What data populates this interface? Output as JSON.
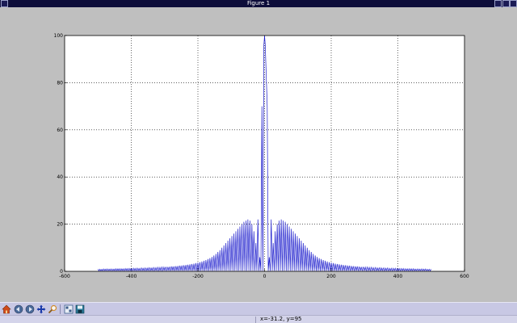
{
  "window": {
    "title": "Figure 1"
  },
  "toolbar": {
    "tools": [
      {
        "name": "home-icon",
        "color": "#d04a1a"
      },
      {
        "name": "back-icon",
        "color": "#4a6a9a"
      },
      {
        "name": "forward-icon",
        "color": "#4a6a9a"
      },
      {
        "name": "pan-icon",
        "color": "#1a3aaa"
      },
      {
        "name": "zoom-icon",
        "color": "#d08a2a"
      },
      {
        "name": "subplots-icon",
        "color": "#3a5a8a"
      },
      {
        "name": "save-icon",
        "color": "#2a7a9a"
      }
    ]
  },
  "status": {
    "coords": "x=-31.2, y=95"
  },
  "chart_data": {
    "type": "line",
    "title": "",
    "xlabel": "",
    "ylabel": "",
    "xlim": [
      -600,
      600
    ],
    "ylim": [
      0,
      100
    ],
    "xticks": [
      "-600",
      "-400",
      "-200",
      "0",
      "200",
      "400",
      "600"
    ],
    "yticks": [
      "0",
      "20",
      "40",
      "60",
      "80",
      "100"
    ],
    "grid": true,
    "line_color": "#1a1acc",
    "series": [
      {
        "x": [
          -500,
          -494,
          -488,
          -482,
          -476,
          -470,
          -464,
          -458,
          -452,
          -446,
          -440,
          -434,
          -428,
          -422,
          -416,
          -410,
          -404,
          -398,
          -392,
          -386,
          -380,
          -374,
          -368,
          -362,
          -356,
          -350,
          -344,
          -338,
          -332,
          -326,
          -320,
          -314,
          -308,
          -302,
          -296,
          -290,
          -284,
          -278,
          -272,
          -266,
          -260,
          -254,
          -248,
          -242,
          -236,
          -230,
          -224,
          -218,
          -212,
          -206,
          -200,
          -194,
          -188,
          -182,
          -176,
          -170,
          -164,
          -158,
          -152,
          -146,
          -140,
          -134,
          -128,
          -122,
          -116,
          -110,
          -104,
          -98,
          -92,
          -86,
          -80,
          -74,
          -68,
          -62,
          -56,
          -50,
          -44,
          -38,
          -32,
          -26,
          -20,
          -14,
          -8,
          -2,
          0,
          2,
          8,
          14,
          20,
          26,
          32,
          38,
          44,
          50,
          56,
          62,
          68,
          74,
          80,
          86,
          92,
          98,
          104,
          110,
          116,
          122,
          128,
          134,
          140,
          146,
          152,
          158,
          164,
          170,
          176,
          182,
          188,
          194,
          200,
          206,
          212,
          218,
          224,
          230,
          236,
          242,
          248,
          254,
          260,
          266,
          272,
          278,
          284,
          290,
          296,
          302,
          308,
          314,
          320,
          326,
          332,
          338,
          344,
          350,
          356,
          362,
          368,
          374,
          380,
          386,
          392,
          398,
          404,
          410,
          416,
          422,
          428,
          434,
          440,
          446,
          452,
          458,
          464,
          470,
          476,
          482,
          488,
          494,
          500
        ],
        "y": [
          0.9,
          0.9,
          0.9,
          1.0,
          1.0,
          1.0,
          1.0,
          1.0,
          1.0,
          1.1,
          1.1,
          1.1,
          1.1,
          1.1,
          1.2,
          1.2,
          1.2,
          1.2,
          1.3,
          1.3,
          1.3,
          1.3,
          1.4,
          1.4,
          1.4,
          1.5,
          1.5,
          1.5,
          1.6,
          1.6,
          1.7,
          1.7,
          1.8,
          1.8,
          1.9,
          1.9,
          2.0,
          2.1,
          2.1,
          2.2,
          2.3,
          2.4,
          2.5,
          2.6,
          2.7,
          2.8,
          3.0,
          3.1,
          3.3,
          3.5,
          3.7,
          3.9,
          4.2,
          4.5,
          4.8,
          5.2,
          5.6,
          6.1,
          6.7,
          7.4,
          8.2,
          9.0,
          10.0,
          11.0,
          12.0,
          13.0,
          14.0,
          15.0,
          16.0,
          17.0,
          18.0,
          19.0,
          20.0,
          21.0,
          21.5,
          22.0,
          21.5,
          20.0,
          17.0,
          12.0,
          22.0,
          6.0,
          70.0,
          96.0,
          100,
          96.0,
          70.0,
          6.0,
          22.0,
          12.0,
          17.0,
          20.0,
          21.5,
          22.0,
          21.5,
          21.0,
          20.0,
          19.0,
          18.0,
          17.0,
          16.0,
          15.0,
          14.0,
          13.0,
          12.0,
          11.0,
          10.0,
          9.0,
          8.2,
          7.4,
          6.7,
          6.1,
          5.6,
          5.2,
          4.8,
          4.5,
          4.2,
          3.9,
          3.7,
          3.5,
          3.3,
          3.1,
          3.0,
          2.8,
          2.7,
          2.6,
          2.5,
          2.4,
          2.3,
          2.2,
          2.1,
          2.1,
          2.0,
          1.9,
          1.9,
          1.8,
          1.8,
          1.7,
          1.7,
          1.6,
          1.6,
          1.5,
          1.5,
          1.5,
          1.4,
          1.4,
          1.4,
          1.3,
          1.3,
          1.3,
          1.3,
          1.2,
          1.2,
          1.2,
          1.2,
          1.1,
          1.1,
          1.1,
          1.1,
          1.1,
          1.0,
          1.0,
          1.0,
          1.0,
          1.0,
          1.0,
          0.9,
          0.9,
          0.9
        ]
      }
    ]
  }
}
